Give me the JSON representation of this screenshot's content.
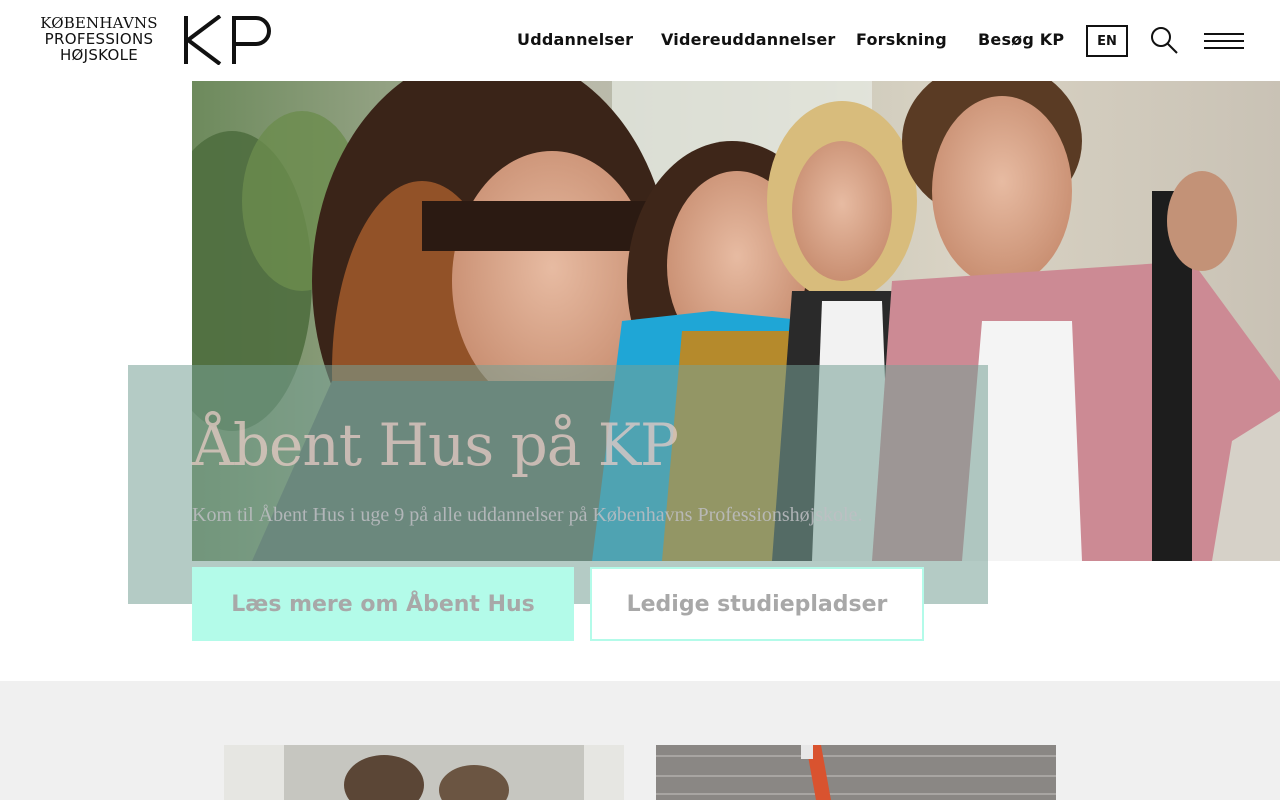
{
  "logo": {
    "line1": "KØBENHAVNS",
    "line2": "PROFESSIONS",
    "line3": "HØJSKOLE",
    "mark": "KP"
  },
  "nav": {
    "items": [
      {
        "label": "Uddannelser"
      },
      {
        "label": "Videreuddannelser"
      },
      {
        "label": "Forskning"
      },
      {
        "label": "Besøg KP"
      }
    ],
    "language": "EN",
    "search_icon": "search-icon",
    "menu_icon": "hamburger-menu-icon"
  },
  "hero": {
    "title": "Åbent Hus på KP",
    "subtitle": "Kom til Åbent Hus i uge 9 på alle uddannelser på Københavns Professionshøjskole.",
    "primary_button": "Læs mere om Åbent Hus",
    "secondary_button": "Ledige studiepladser"
  },
  "colors": {
    "accent_mint": "#b3fbe9",
    "panel_teal": "#76a096",
    "lower_bg": "#f0f0f0"
  }
}
